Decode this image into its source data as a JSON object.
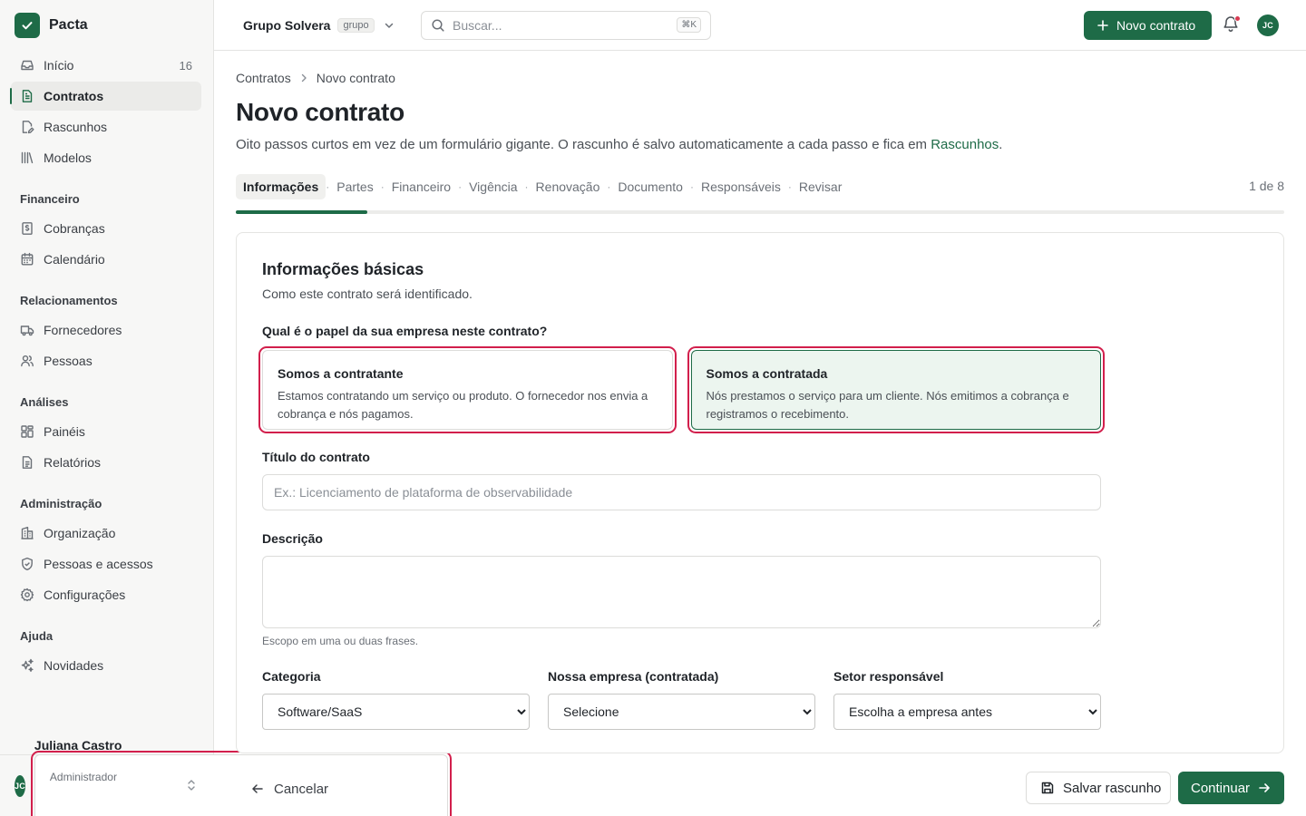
{
  "brand": {
    "name": "Pacta"
  },
  "sidebar": {
    "items_top": [
      {
        "label": "Início",
        "icon": "inbox-icon",
        "count": "16",
        "active": false
      },
      {
        "label": "Contratos",
        "icon": "file-text-icon",
        "count": "",
        "active": true
      },
      {
        "label": "Rascunhos",
        "icon": "file-edit-icon",
        "count": "",
        "active": false
      },
      {
        "label": "Modelos",
        "icon": "library-icon",
        "count": "",
        "active": false
      }
    ],
    "sections": [
      {
        "title": "Financeiro",
        "items": [
          {
            "label": "Cobranças",
            "icon": "receipt-icon"
          },
          {
            "label": "Calendário",
            "icon": "calendar-icon"
          }
        ]
      },
      {
        "title": "Relacionamentos",
        "items": [
          {
            "label": "Fornecedores",
            "icon": "truck-icon"
          },
          {
            "label": "Pessoas",
            "icon": "users-icon"
          }
        ]
      },
      {
        "title": "Análises",
        "items": [
          {
            "label": "Painéis",
            "icon": "dashboard-icon"
          },
          {
            "label": "Relatórios",
            "icon": "report-icon"
          }
        ]
      },
      {
        "title": "Administração",
        "items": [
          {
            "label": "Organização",
            "icon": "building-icon"
          },
          {
            "label": "Pessoas e acessos",
            "icon": "shield-icon"
          },
          {
            "label": "Configurações",
            "icon": "gear-icon"
          }
        ]
      },
      {
        "title": "Ajuda",
        "items": [
          {
            "label": "Novidades",
            "icon": "sparkles-icon"
          }
        ]
      }
    ],
    "user": {
      "initials": "JC",
      "name": "Juliana Castro",
      "role": "Administrador"
    }
  },
  "topbar": {
    "org_name": "Grupo Solvera",
    "org_badge": "grupo",
    "search_placeholder": "Buscar...",
    "search_shortcut": "⌘K",
    "new_contract_label": "Novo contrato",
    "avatar_initials": "JC"
  },
  "page": {
    "breadcrumb": [
      "Contratos",
      "Novo contrato"
    ],
    "title": "Novo contrato",
    "description_prefix": "Oito passos curtos em vez de um formulário gigante. O rascunho é salvo automaticamente a cada passo e fica em ",
    "description_link": "Rascunhos",
    "description_suffix": "."
  },
  "steps": {
    "items": [
      "Informações",
      "Partes",
      "Financeiro",
      "Vigência",
      "Renovação",
      "Documento",
      "Responsáveis",
      "Revisar"
    ],
    "active_index": 0,
    "counter": "1 de 8",
    "progress": 0.125
  },
  "form": {
    "section_title": "Informações básicas",
    "section_subtitle": "Como este contrato será identificado.",
    "role_question": "Qual é o papel da sua empresa neste contrato?",
    "roles": [
      {
        "title": "Somos a contratante",
        "description": "Estamos contratando um serviço ou produto. O fornecedor nos envia a cobrança e nós pagamos.",
        "selected": false
      },
      {
        "title": "Somos a contratada",
        "description": "Nós prestamos o serviço para um cliente. Nós emitimos a cobrança e registramos o recebimento.",
        "selected": true
      }
    ],
    "title_label": "Título do contrato",
    "title_placeholder": "Ex.: Licenciamento de plataforma de observabilidade",
    "title_value": "",
    "description_label": "Descrição",
    "description_value": "",
    "description_hint": "Escopo em uma ou duas frases.",
    "category_label": "Categoria",
    "category_value": "Software/SaaS",
    "company_label": "Nossa empresa (contratada)",
    "company_value": "Selecione",
    "sector_label": "Setor responsável",
    "sector_value": "Escolha a empresa antes"
  },
  "footer": {
    "cancel_label": "Cancelar",
    "save_draft_label": "Salvar rascunho",
    "continue_label": "Continuar"
  },
  "colors": {
    "brand": "#1e6b47",
    "selected_card_bg": "#ecf5ef",
    "highlight_outline": "#d21f4c",
    "notification_dot": "#d83a52"
  }
}
